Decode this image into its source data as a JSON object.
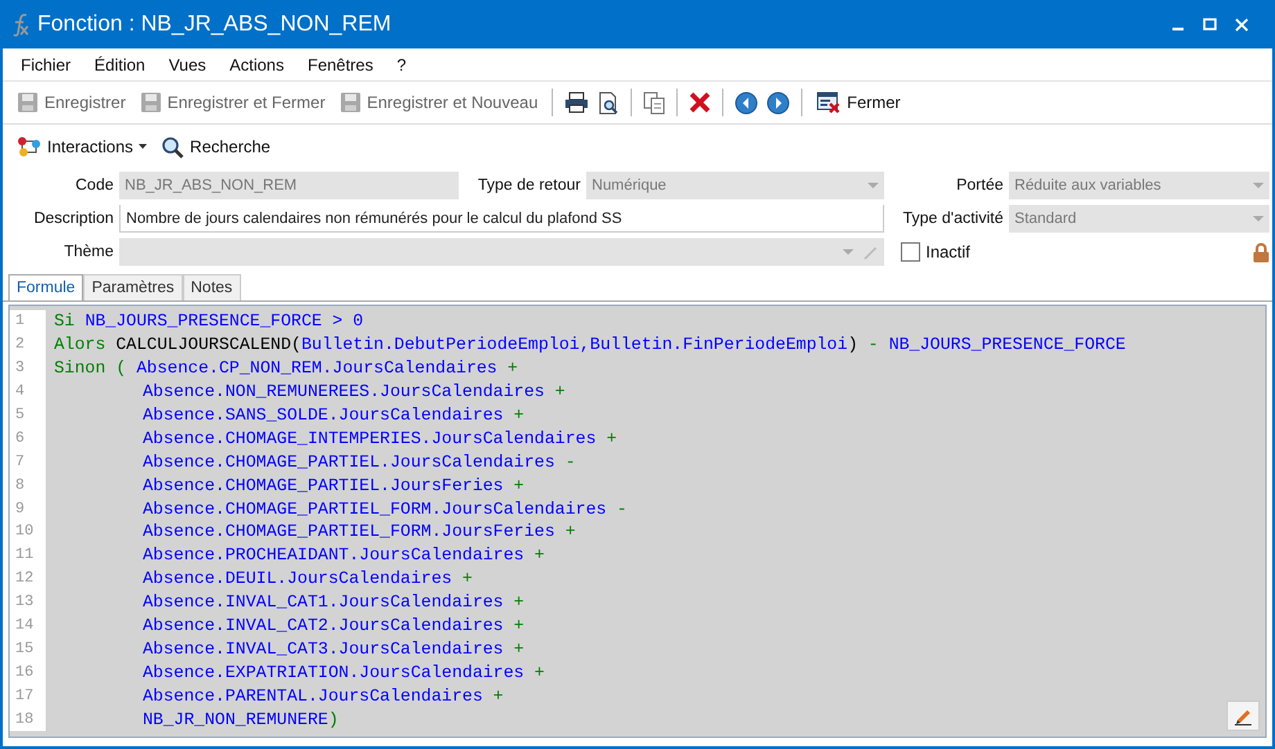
{
  "window": {
    "title": "Fonction : NB_JR_ABS_NON_REM"
  },
  "menu": [
    "Fichier",
    "Édition",
    "Vues",
    "Actions",
    "Fenêtres",
    "?"
  ],
  "toolbar": [
    {
      "kind": "save",
      "label": "Enregistrer",
      "disabled": true
    },
    {
      "kind": "save-close",
      "label": "Enregistrer et Fermer",
      "disabled": true
    },
    {
      "kind": "save-new",
      "label": "Enregistrer et Nouveau",
      "disabled": true
    },
    {
      "kind": "sep"
    },
    {
      "kind": "print"
    },
    {
      "kind": "preview"
    },
    {
      "kind": "sep"
    },
    {
      "kind": "copy"
    },
    {
      "kind": "sep"
    },
    {
      "kind": "delete"
    },
    {
      "kind": "sep"
    },
    {
      "kind": "prev"
    },
    {
      "kind": "next"
    },
    {
      "kind": "sep"
    },
    {
      "kind": "close",
      "label": "Fermer",
      "disabled": false
    }
  ],
  "toolbar2": [
    {
      "kind": "interactions",
      "label": "Interactions"
    },
    {
      "kind": "search",
      "label": "Recherche"
    }
  ],
  "form": {
    "code": {
      "label": "Code",
      "value": "NB_JR_ABS_NON_REM"
    },
    "type_retour": {
      "label": "Type de retour",
      "value": "Numérique"
    },
    "portee": {
      "label": "Portée",
      "value": "Réduite aux variables"
    },
    "description": {
      "label": "Description",
      "value": "Nombre de jours calendaires non rémunérés pour le calcul du plafond SS"
    },
    "type_activite": {
      "label": "Type d'activité",
      "value": "Standard"
    },
    "theme": {
      "label": "Thème"
    },
    "inactif": {
      "label": "Inactif",
      "checked": false
    },
    "locked": true
  },
  "tabs": [
    {
      "label": "Formule",
      "selected": true
    },
    {
      "label": "Paramètres",
      "selected": false
    },
    {
      "label": "Notes",
      "selected": false
    }
  ],
  "code_lines": [
    {
      "number": "1",
      "indented": false,
      "tokens": [
        {
          "kind": "keyword",
          "text": "Si "
        },
        {
          "kind": "ident",
          "text": "NB_JOURS_PRESENCE_FORCE > 0"
        }
      ]
    },
    {
      "number": "2",
      "indented": false,
      "tokens": [
        {
          "kind": "keyword",
          "text": "Alors "
        },
        {
          "kind": "func",
          "text": "CALCULJOURSCALEND("
        },
        {
          "kind": "ident",
          "text": "Bulletin.DebutPeriodeEmploi,Bulletin.FinPeriodeEmploi"
        },
        {
          "kind": "func",
          "text": ")"
        },
        {
          "kind": "op",
          "text": " - "
        },
        {
          "kind": "ident",
          "text": "NB_JOURS_PRESENCE_FORCE"
        }
      ]
    },
    {
      "number": "3",
      "indented": false,
      "tokens": [
        {
          "kind": "keyword",
          "text": "Sinon ( "
        },
        {
          "kind": "ident",
          "text": "Absence.CP_NON_REM.JoursCalendaires"
        },
        {
          "kind": "op",
          "text": " +"
        }
      ]
    },
    {
      "number": "4",
      "indented": true,
      "tokens": [
        {
          "kind": "ident",
          "text": "Absence.NON_REMUNEREES.JoursCalendaires"
        },
        {
          "kind": "op",
          "text": " +"
        }
      ]
    },
    {
      "number": "5",
      "indented": true,
      "tokens": [
        {
          "kind": "ident",
          "text": "Absence.SANS_SOLDE.JoursCalendaires"
        },
        {
          "kind": "op",
          "text": " +"
        }
      ]
    },
    {
      "number": "6",
      "indented": true,
      "tokens": [
        {
          "kind": "ident",
          "text": "Absence.CHOMAGE_INTEMPERIES.JoursCalendaires"
        },
        {
          "kind": "op",
          "text": " +"
        }
      ]
    },
    {
      "number": "7",
      "indented": true,
      "tokens": [
        {
          "kind": "ident",
          "text": "Absence.CHOMAGE_PARTIEL.JoursCalendaires"
        },
        {
          "kind": "op",
          "text": " -"
        }
      ]
    },
    {
      "number": "8",
      "indented": true,
      "tokens": [
        {
          "kind": "ident",
          "text": "Absence.CHOMAGE_PARTIEL.JoursFeries"
        },
        {
          "kind": "op",
          "text": " +"
        }
      ]
    },
    {
      "number": "9",
      "indented": true,
      "tokens": [
        {
          "kind": "ident",
          "text": "Absence.CHOMAGE_PARTIEL_FORM.JoursCalendaires"
        },
        {
          "kind": "op",
          "text": " -"
        }
      ]
    },
    {
      "number": "10",
      "indented": true,
      "tokens": [
        {
          "kind": "ident",
          "text": "Absence.CHOMAGE_PARTIEL_FORM.JoursFeries"
        },
        {
          "kind": "op",
          "text": " +"
        }
      ]
    },
    {
      "number": "11",
      "indented": true,
      "tokens": [
        {
          "kind": "ident",
          "text": "Absence.PROCHEAIDANT.JoursCalendaires"
        },
        {
          "kind": "op",
          "text": " +"
        }
      ]
    },
    {
      "number": "12",
      "indented": true,
      "tokens": [
        {
          "kind": "ident",
          "text": "Absence.DEUIL.JoursCalendaires"
        },
        {
          "kind": "op",
          "text": " +"
        }
      ]
    },
    {
      "number": "13",
      "indented": true,
      "tokens": [
        {
          "kind": "ident",
          "text": "Absence.INVAL_CAT1.JoursCalendaires"
        },
        {
          "kind": "op",
          "text": " +"
        }
      ]
    },
    {
      "number": "14",
      "indented": true,
      "tokens": [
        {
          "kind": "ident",
          "text": "Absence.INVAL_CAT2.JoursCalendaires"
        },
        {
          "kind": "op",
          "text": " +"
        }
      ]
    },
    {
      "number": "15",
      "indented": true,
      "tokens": [
        {
          "kind": "ident",
          "text": "Absence.INVAL_CAT3.JoursCalendaires"
        },
        {
          "kind": "op",
          "text": " +"
        }
      ]
    },
    {
      "number": "16",
      "indented": true,
      "tokens": [
        {
          "kind": "ident",
          "text": "Absence.EXPATRIATION.JoursCalendaires"
        },
        {
          "kind": "op",
          "text": " +"
        }
      ]
    },
    {
      "number": "17",
      "indented": true,
      "tokens": [
        {
          "kind": "ident",
          "text": "Absence.PARENTAL.JoursCalendaires"
        },
        {
          "kind": "op",
          "text": " +"
        }
      ]
    },
    {
      "number": "18",
      "indented": true,
      "tokens": [
        {
          "kind": "ident",
          "text": "NB_JR_NON_REMUNERE"
        },
        {
          "kind": "op",
          "text": ")"
        }
      ]
    }
  ]
}
